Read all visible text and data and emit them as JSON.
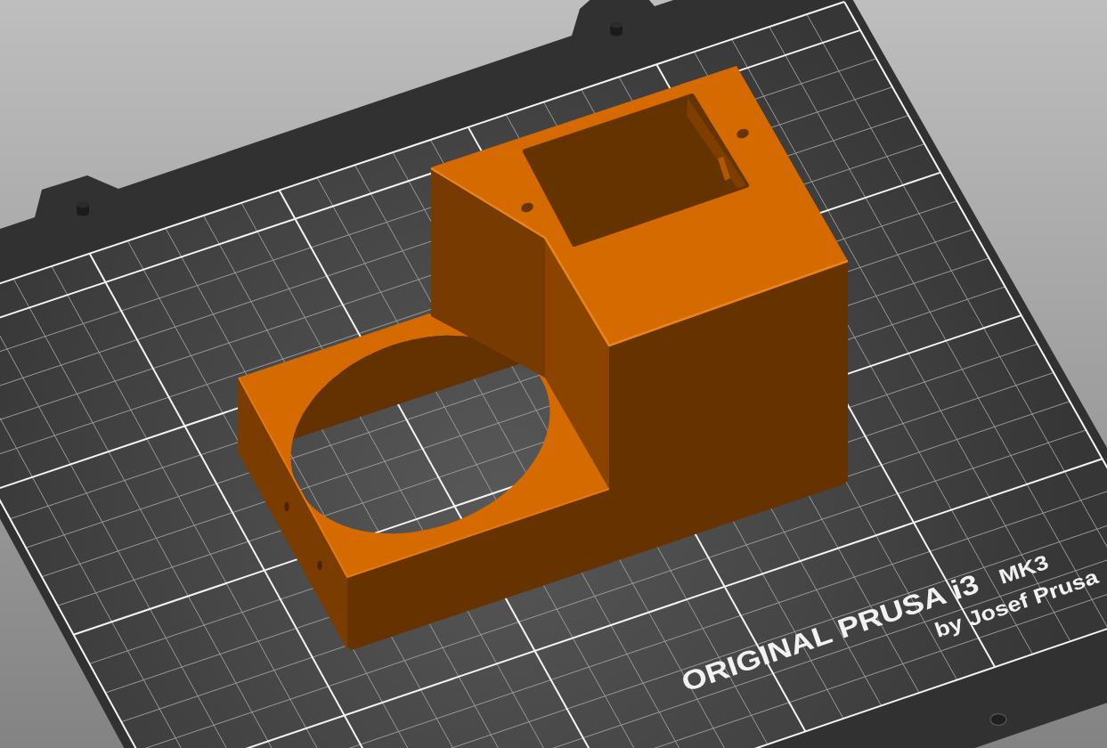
{
  "viewport": {
    "bed": {
      "logo": {
        "title": "ORIGINAL PRUSA i3",
        "model": "MK3",
        "byline": "by Josef Prusa"
      }
    }
  }
}
